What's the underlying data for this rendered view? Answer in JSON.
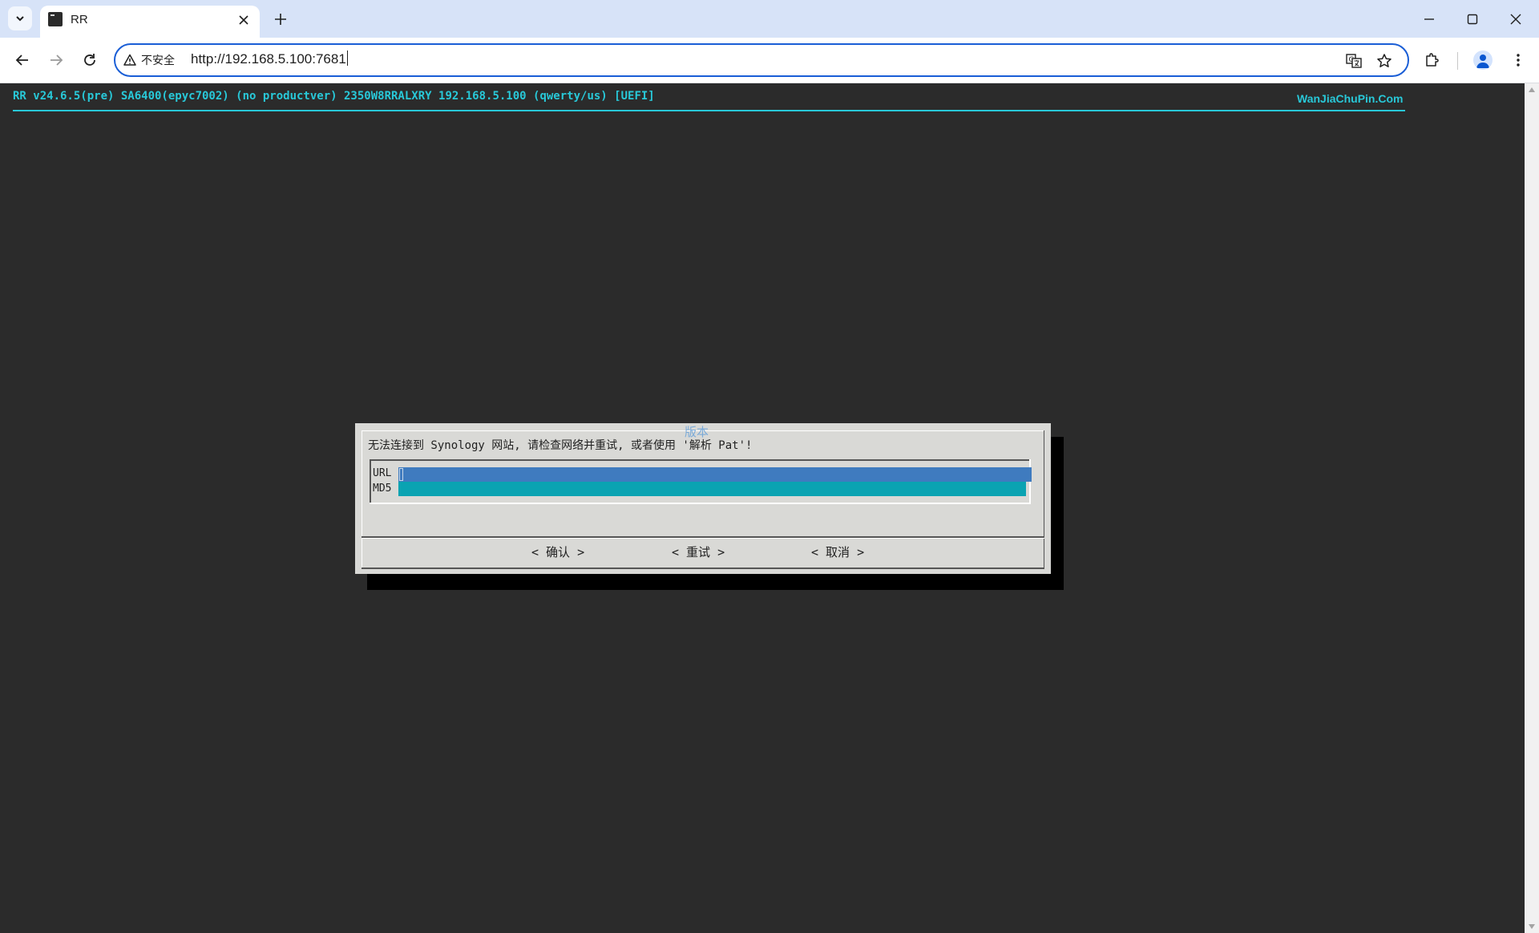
{
  "browser": {
    "tab": {
      "title": "RR"
    },
    "address_bar": {
      "security_label": "不安全",
      "url": "http://192.168.5.100:7681"
    },
    "icons": {
      "tab_search": "chevron-down-icon",
      "tab_close": "close-icon",
      "new_tab": "plus-icon",
      "minimize": "minimize-icon",
      "maximize": "maximize-icon",
      "close_window": "close-icon",
      "back": "arrow-left-icon",
      "forward": "arrow-right-icon",
      "reload": "reload-icon",
      "warning": "warning-triangle-icon",
      "translate": "translate-icon",
      "bookmark": "star-icon",
      "extensions": "puzzle-icon",
      "profile": "avatar-icon",
      "menu": "kebab-menu-icon"
    }
  },
  "terminal": {
    "header": "RR v24.6.5(pre) SA6400(epyc7002) (no productver) 2350W8RRALXRY 192.168.5.100 (qwerty/us) [UEFI]",
    "brand": "WanJiaChuPin.Com",
    "colors": {
      "background": "#2b2b2b",
      "accent": "#28c8d8"
    }
  },
  "dialog": {
    "title": "版本",
    "message": "无法连接到 Synology 网站, 请检查网络并重试, 或者使用 '解析 Pat'!",
    "fields": [
      {
        "label": "URL",
        "value": ""
      },
      {
        "label": "MD5",
        "value": ""
      }
    ],
    "buttons": {
      "ok": "< 确认 >",
      "retry": "< 重试 >",
      "cancel": "< 取消 >"
    },
    "colors": {
      "url_field": "#3f7bbf",
      "md5_field": "#0aa3b2",
      "title": "#7aaad8"
    }
  }
}
